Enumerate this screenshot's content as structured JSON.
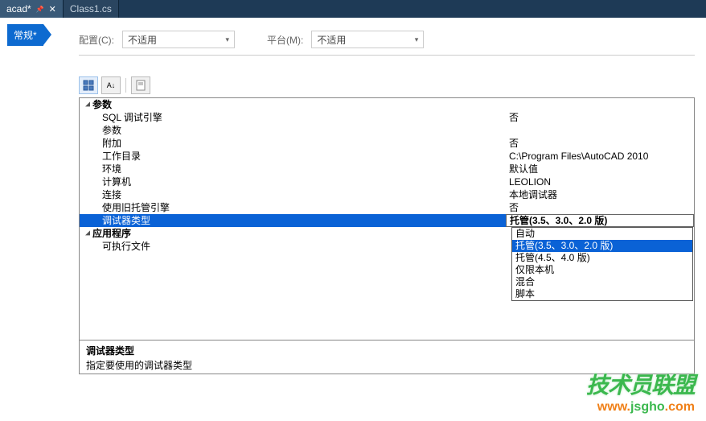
{
  "titlebar": {
    "tabs": [
      {
        "label": "acad*",
        "pinned": true,
        "closable": true,
        "active": true
      },
      {
        "label": "Class1.cs",
        "pinned": false,
        "closable": false,
        "active": false
      }
    ]
  },
  "sidebar_tab": {
    "label": "常规*"
  },
  "config": {
    "config_label": "配置(C):",
    "config_value": "不适用",
    "platform_label": "平台(M):",
    "platform_value": "不适用"
  },
  "toolbar": {
    "categorize_tip": "分类",
    "sort_tip": "A↓",
    "page_tip": "页"
  },
  "grid": {
    "sections": [
      {
        "name": "参数",
        "rows": [
          {
            "label": "SQL 调试引擎",
            "value": "否"
          },
          {
            "label": "参数",
            "value": ""
          },
          {
            "label": "附加",
            "value": "否"
          },
          {
            "label": "工作目录",
            "value": "C:\\Program Files\\AutoCAD 2010"
          },
          {
            "label": "环境",
            "value": "默认值"
          },
          {
            "label": "计算机",
            "value": "LEOLION"
          },
          {
            "label": "连接",
            "value": "本地调试器"
          },
          {
            "label": "使用旧托管引擎",
            "value": "否"
          },
          {
            "label": "调试器类型",
            "value": "托管(3.5、3.0、2.0 版)",
            "selected": true
          }
        ]
      },
      {
        "name": "应用程序",
        "rows": [
          {
            "label": "可执行文件",
            "value": ""
          }
        ]
      }
    ]
  },
  "debugger_dropdown": {
    "options": [
      "自动",
      "托管(3.5、3.0、2.0 版)",
      "托管(4.5、4.0 版)",
      "仅限本机",
      "混合",
      "脚本"
    ],
    "selected_index": 1
  },
  "description": {
    "title": "调试器类型",
    "text": "指定要使用的调试器类型"
  },
  "watermark": {
    "line1": "技术员联盟",
    "line2_a": "www.",
    "line2_b": "jsgho",
    "line2_c": ".com"
  }
}
